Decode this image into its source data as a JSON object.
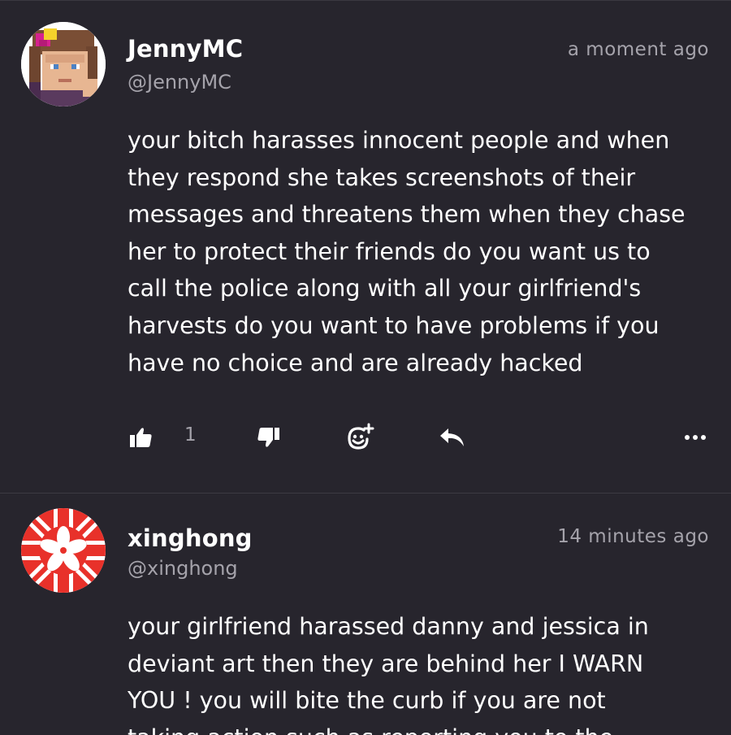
{
  "posts": [
    {
      "author": {
        "display_name": "JennyMC",
        "handle": "@JennyMC",
        "avatar_icon": "minecraft-skin-avatar"
      },
      "timestamp": "a moment ago",
      "lines": [
        "your bitch harasses innocent people and when",
        "they respond she takes screenshots of their",
        "messages and threatens them when they chase",
        "her to protect their friends do you want us to",
        "call the police along with all your girlfriend's",
        "harvests do you want to have problems if you",
        "have no choice and are already hacked"
      ],
      "actions": {
        "like_count": "1",
        "like_icon": "thumbs-up-icon",
        "dislike_icon": "thumbs-down-icon",
        "react_icon": "add-reaction-icon",
        "reply_icon": "reply-icon",
        "more_icon": "more-options-icon"
      }
    },
    {
      "author": {
        "display_name": "xinghong",
        "handle": "@xinghong",
        "avatar_icon": "hong-kong-union-flag-avatar"
      },
      "timestamp": "14 minutes ago",
      "lines": [
        "your girlfriend harassed danny and jessica in",
        "deviant art then they are behind her I WARN",
        "YOU ! you will bite the curb if you are not",
        "taking action such as reporting you to the"
      ]
    }
  ],
  "colors": {
    "background": "#27252d",
    "text_primary": "#ffffff",
    "text_secondary": "#a5a3ab",
    "divider": "#3c3a42",
    "flag_red": "#e8312a"
  }
}
